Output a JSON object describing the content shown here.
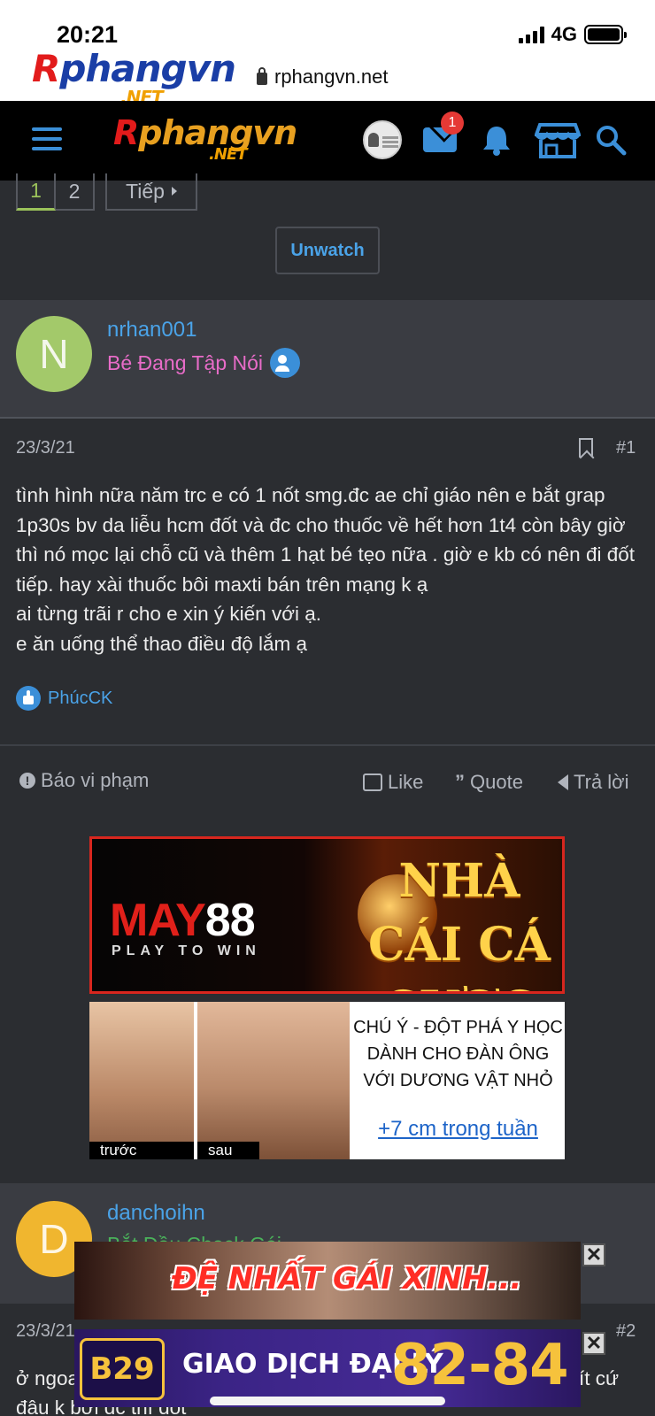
{
  "status_bar": {
    "time": "20:21",
    "network": "4G"
  },
  "browser": {
    "url": "rphangvn.net",
    "logo_small": {
      "part1": "R",
      "part2": "phangvn",
      "net": ".NET"
    }
  },
  "navbar": {
    "logo": {
      "part1": "R",
      "part2": "phangvn",
      "net": ".NET"
    },
    "mail_badge": "1"
  },
  "pagination": {
    "pages": [
      "1",
      "2"
    ],
    "next_label": "Tiếp"
  },
  "unwatch_label": "Unwatch",
  "post1": {
    "avatar_letter": "N",
    "username": "nrhan001",
    "user_title": "Bé Đang Tập Nói",
    "date": "23/3/21",
    "number": "#1",
    "lines": [
      "tình hình nữa năm trc e có 1 nốt smg.đc ae chỉ giáo nên e bắt grap 1p30s bv da liễu hcm đốt và đc cho thuốc về hết hơn 1t4 còn bây giờ thì nó mọc lại chỗ cũ và thêm 1 hạt bé tẹo nữa . giờ e kb có nên đi đốt tiếp. hay xài thuốc bôi maxti bán trên mạng k ạ",
      "ai từng trãi r cho e xin ý kiến với ạ.",
      "e ăn uống thể thao điều độ lắm ạ"
    ],
    "liked_by": "PhúcCK"
  },
  "actions": {
    "report": "Báo vi phạm",
    "like": "Like",
    "quote": "Quote",
    "reply": "Trả lời"
  },
  "ad1": {
    "brand": "MAY",
    "brand_num": "88",
    "tagline": "PLAY TO WIN",
    "headline": "NHÀ CÁI CÁ CƯỢC"
  },
  "ad2": {
    "before": "trước",
    "after": "sau",
    "text": "CHÚ Ý - ĐỘT PHÁ Y HỌC DÀNH CHO ĐÀN ÔNG VỚI DƯƠNG VẬT NHỎ",
    "link": "+7 cm trong tuần"
  },
  "post2": {
    "avatar_letter": "D",
    "username": "danchoihn",
    "user_title": "Bắt Đầu Check Gái",
    "date": "23/3/21",
    "number": "#2",
    "text_left": "ở ngoa",
    "text_right": "ít cứ",
    "text_line2": "đâu k bơi đc thì đốt"
  },
  "float_ad1": {
    "text": "ĐỆ NHẤT GÁI XINH..."
  },
  "float_ad2": {
    "logo": "B29",
    "text": "GIAO DỊCH ĐẠI LÝ",
    "number": "82-84"
  },
  "close_glyph": "✕"
}
